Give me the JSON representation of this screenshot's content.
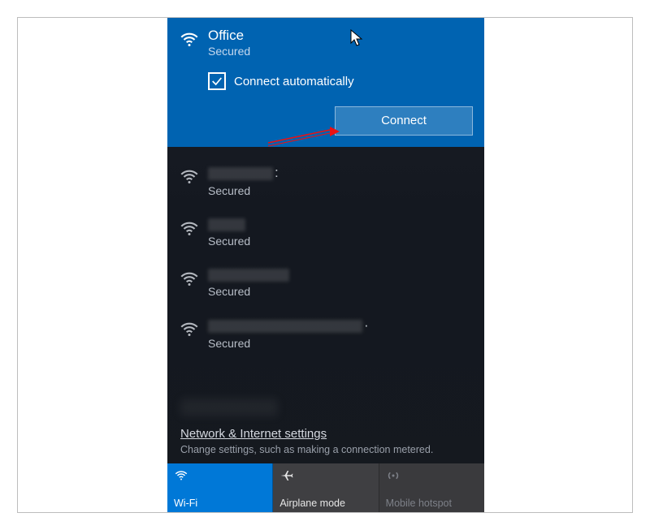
{
  "selected_network": {
    "ssid": "Office",
    "status": "Secured",
    "auto_connect_label": "Connect automatically",
    "auto_connect_checked": true,
    "connect_button": "Connect"
  },
  "networks": [
    {
      "status": "Secured",
      "ssid_blur_width": 80,
      "trailing_punct": ":"
    },
    {
      "status": "Secured",
      "ssid_blur_width": 46,
      "trailing_punct": ""
    },
    {
      "status": "Secured",
      "ssid_blur_width": 100,
      "trailing_punct": ""
    },
    {
      "status": "Secured",
      "ssid_blur_width": 190,
      "trailing_punct": "·"
    }
  ],
  "settings": {
    "link": "Network & Internet settings",
    "description": "Change settings, such as making a connection metered."
  },
  "tiles": {
    "wifi": "Wi-Fi",
    "airplane": "Airplane mode",
    "hotspot": "Mobile hotspot"
  }
}
